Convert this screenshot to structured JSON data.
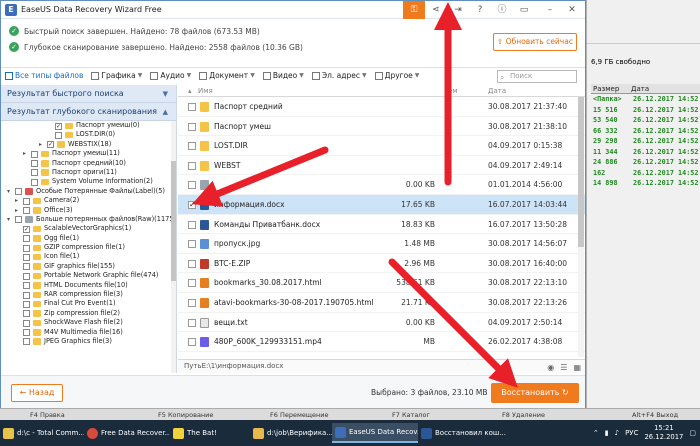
{
  "window": {
    "title": "EaseUS Data Recovery Wizard Free"
  },
  "status": {
    "quick": "Быстрый поиск завершен. Найдено: 78 файлов (673.53 MB)",
    "deep": "Глубокое сканирование завершено. Найдено: 2558 файлов (10.36 GB)",
    "update_label": "Обновить сейчас"
  },
  "filters": [
    "Все типы файлов",
    "Графика",
    "Аудио",
    "Документ",
    "Видео",
    "Эл. адрес",
    "Другое"
  ],
  "search_placeholder": "Поиск",
  "categories": {
    "quick": "Результат быстрого поиска",
    "deep": "Результат глубокого сканирования"
  },
  "tree": [
    "Паспорт умеиш(0)",
    "LOST.DIR(0)",
    "WEBSTIX(18)",
    "Паспорт умеиш(11)",
    "Паспорт средний(10)",
    "Паспорт ориги(11)",
    "System Volume Information(2)",
    "Особые Потерянные Файлы(Label)(5)",
    "Camera(2)",
    "Office(3)",
    "Больше потерянных файлов(Raw)(1175)",
    "ScalableVectorGraphics(1)",
    "Ogg file(1)",
    "GZIP compression file(1)",
    "Icon file(1)",
    "GIF graphics file(155)",
    "Portable Network Graphic file(474)",
    "HTML Documents file(10)",
    "RAR compression file(3)",
    "Final Cut Pro Event(1)",
    "Zip compression file(2)",
    "ShockWave Flash file(2)",
    "M4V Multimedia file(16)",
    "JPEG Graphics file(3)"
  ],
  "list": {
    "col_name": "Имя",
    "col_date": "Дата",
    "col_size_partial": "ем",
    "rows": [
      {
        "name": "Паспорт средний",
        "size": "",
        "date": "30.08.2017 21:37:40"
      },
      {
        "name": "Паспорт умеш",
        "size": "",
        "date": "30.08.2017 21:38:10"
      },
      {
        "name": "LOST.DIR",
        "size": "",
        "date": "04.09.2017 0:15:38"
      },
      {
        "name": "WEBST",
        "size": "",
        "date": "04.09.2017 2:49:14"
      },
      {
        "name": "",
        "size": "0.00 KB",
        "date": "01.01.2014 4:56:00"
      },
      {
        "name": "информация.docx",
        "size": "17.65 KB",
        "date": "16.07.2017 14:03:44"
      },
      {
        "name": "Команды Приватбанк.docx",
        "size": "18.83 KB",
        "date": "16.07.2017 13:50:28"
      },
      {
        "name": "пропуск.jpg",
        "size": "1.48 MB",
        "date": "30.08.2017 14:56:07"
      },
      {
        "name": "BTC-E.ZIP",
        "size": "2.96 MB",
        "date": "30.08.2017 16:40:00"
      },
      {
        "name": "bookmarks_30.08.2017.html",
        "size": "538.61 KB",
        "date": "30.08.2017 22:13:10"
      },
      {
        "name": "atavi-bookmarks-30-08-2017.190705.html",
        "size": "21.71 KB",
        "date": "30.08.2017 22:13:26"
      },
      {
        "name": "вещи.txt",
        "size": "0.00 KB",
        "date": "04.09.2017 2:50:14"
      },
      {
        "name": "480P_600K_129933151.mp4",
        "size": "MB",
        "date": "26.02.2017 4:38:08"
      }
    ]
  },
  "path": "ПутьE:\\1\\информация.docx",
  "bottom": {
    "back": "Назад",
    "selected": "Выбрано: 3 файлов, 23.10 MB",
    "recover": "Восстановить"
  },
  "bg_app": {
    "free": "6,9 ГБ свободно",
    "col_size": "Размер",
    "col_date": "Дата",
    "rows": [
      {
        "size": "<Папка>",
        "date": "26.12.2017 14:52"
      },
      {
        "size": "15 516",
        "date": "26.12.2017 14:52"
      },
      {
        "size": "53 540",
        "date": "26.12.2017 14:52"
      },
      {
        "size": "66 332",
        "date": "26.12.2017 14:52"
      },
      {
        "size": "29 298",
        "date": "26.12.2017 14:52"
      },
      {
        "size": "11 344",
        "date": "26.12.2017 14:52"
      },
      {
        "size": "24 886",
        "date": "26.12.2017 14:52"
      },
      {
        "size": "162",
        "date": "26.12.2017 14:52"
      },
      {
        "size": "14 898",
        "date": "26.12.2017 14:52"
      }
    ]
  },
  "fkeys": [
    "F4 Правка",
    "F5 Копирование",
    "F6 Перемещение",
    "F7 Каталог",
    "F8 Удаление",
    "Alt+F4 Выход"
  ],
  "taskbar": {
    "items": [
      "d:\\c - Total Comm...",
      "Free Data Recover...",
      "The Bat!",
      "d:\\job\\Верифика...",
      "EaseUS Data Recov...",
      "Восстановил кош..."
    ],
    "lang": "РУС",
    "time": "15:21",
    "date": "26.12.2017"
  }
}
